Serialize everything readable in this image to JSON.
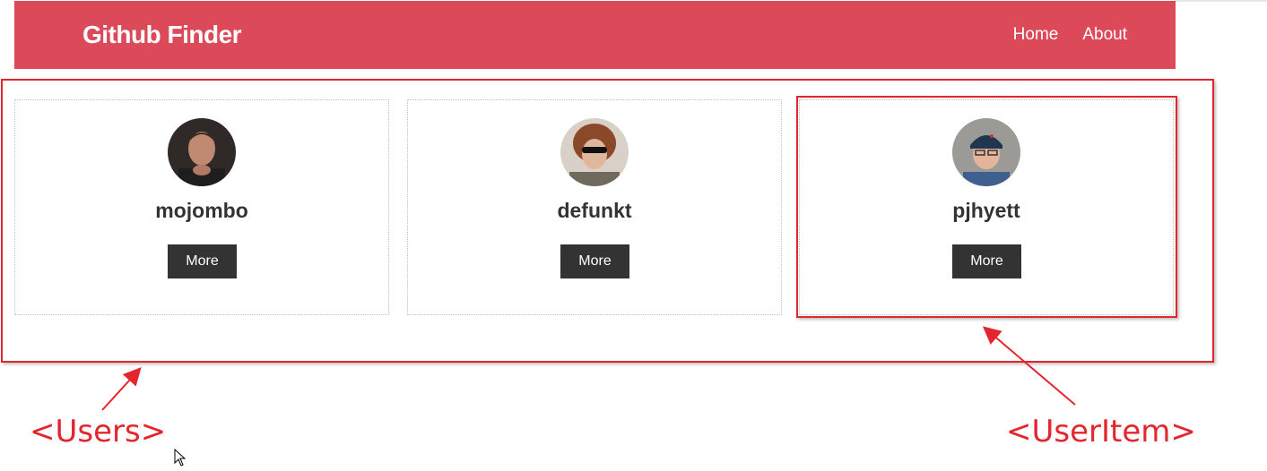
{
  "navbar": {
    "brand": "Github Finder",
    "links": [
      "Home",
      "About"
    ],
    "color": "#dc4a59"
  },
  "users": [
    {
      "login": "mojombo",
      "button_label": "More"
    },
    {
      "login": "defunkt",
      "button_label": "More"
    },
    {
      "login": "pjhyett",
      "button_label": "More"
    }
  ],
  "annotations": {
    "users_label": "<Users>",
    "useritem_label": "<UserItem>",
    "color": "#e3262d"
  }
}
